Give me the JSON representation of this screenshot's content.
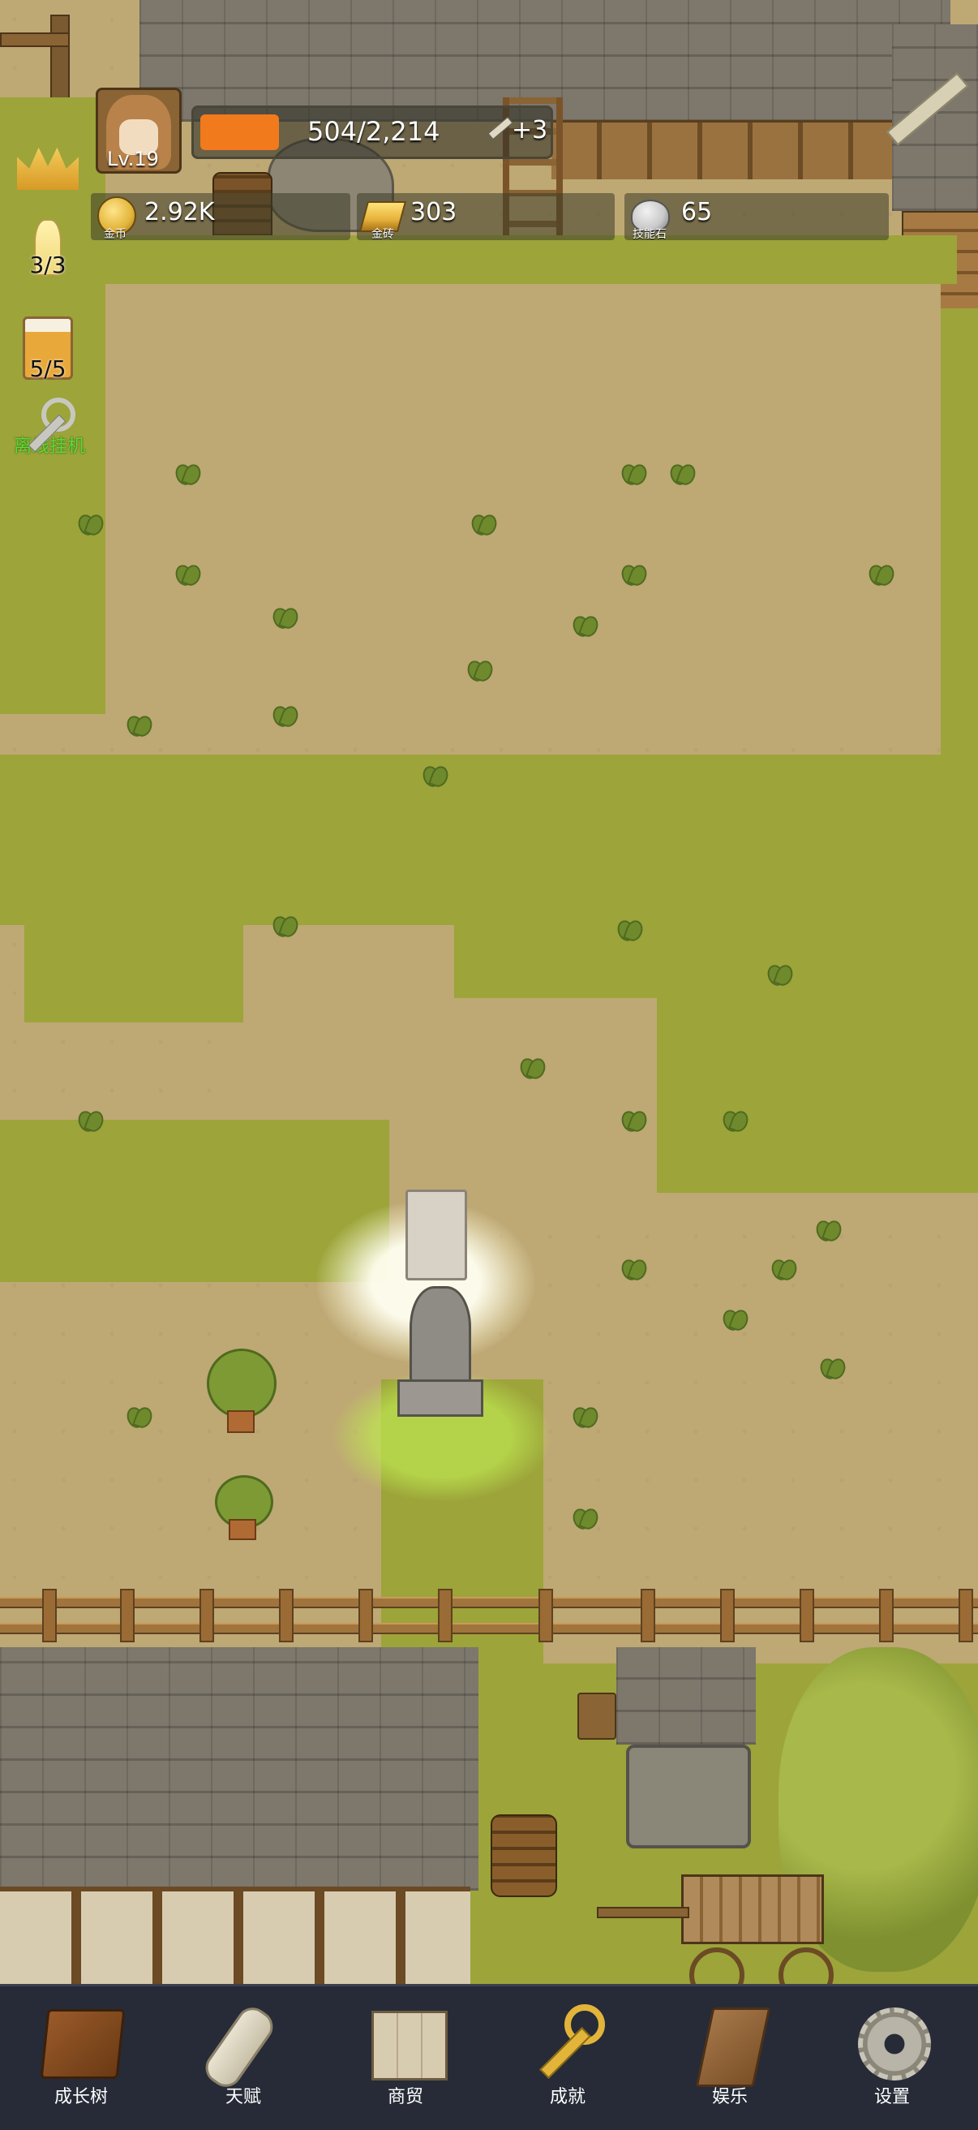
{
  "player": {
    "level": "Lv.19",
    "exp": "504/2,214",
    "exp_progress": 0.2277,
    "bonus": "+3"
  },
  "resources": [
    {
      "value": "2.92K",
      "label": "金币",
      "icon": "gold-coin-icon",
      "color": "#e2b43a"
    },
    {
      "value": "303",
      "label": "金砖",
      "icon": "gold-brick-icon",
      "color": "#e7b23a"
    },
    {
      "value": "65",
      "label": "技能石",
      "icon": "skill-stone-icon",
      "color": "#c9c9c9"
    }
  ],
  "side_items": [
    {
      "icon": "crown-icon",
      "count": ""
    },
    {
      "icon": "candle-icon",
      "count": "3/3"
    },
    {
      "icon": "beer-icon",
      "count": "5/5"
    },
    {
      "icon": "key-icon",
      "count": "离线挂机"
    }
  ],
  "nav": [
    {
      "label": "成长树",
      "icon": "book-icon"
    },
    {
      "label": "天赋",
      "icon": "scroll-icon"
    },
    {
      "label": "商贸",
      "icon": "map-icon"
    },
    {
      "label": "成就",
      "icon": "key-icon"
    },
    {
      "label": "娱乐",
      "icon": "parchment-icon"
    },
    {
      "label": "设置",
      "icon": "gear-icon"
    }
  ],
  "colors": {
    "exp_bar": "#f07a1c",
    "nav_bg": "#262b37",
    "idle_text": "#5cdc34"
  }
}
